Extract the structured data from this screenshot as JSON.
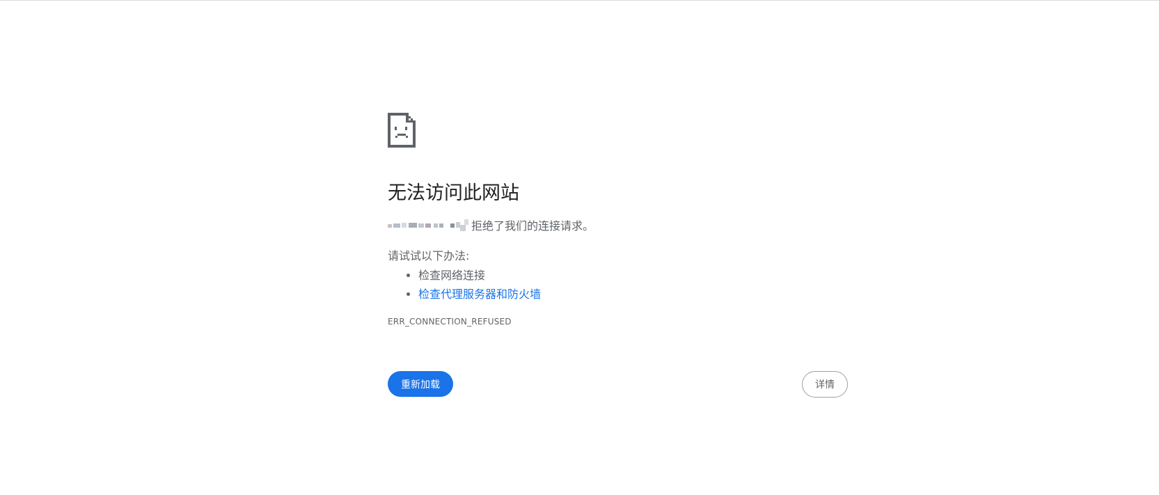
{
  "error_page": {
    "icon": "sad-page-icon",
    "title": "无法访问此网站",
    "message_suffix": "拒绝了我们的连接请求。",
    "suggestions_title": "请试试以下办法:",
    "suggestions": [
      {
        "label": "检查网络连接",
        "is_link": false
      },
      {
        "label": "检查代理服务器和防火墙",
        "is_link": true
      }
    ],
    "error_code": "ERR_CONNECTION_REFUSED",
    "reload_label": "重新加载",
    "details_label": "详情"
  },
  "colors": {
    "accent": "#1a73e8",
    "title_text": "#202124",
    "body_text": "#5f6368",
    "icon": "#5f6368"
  }
}
